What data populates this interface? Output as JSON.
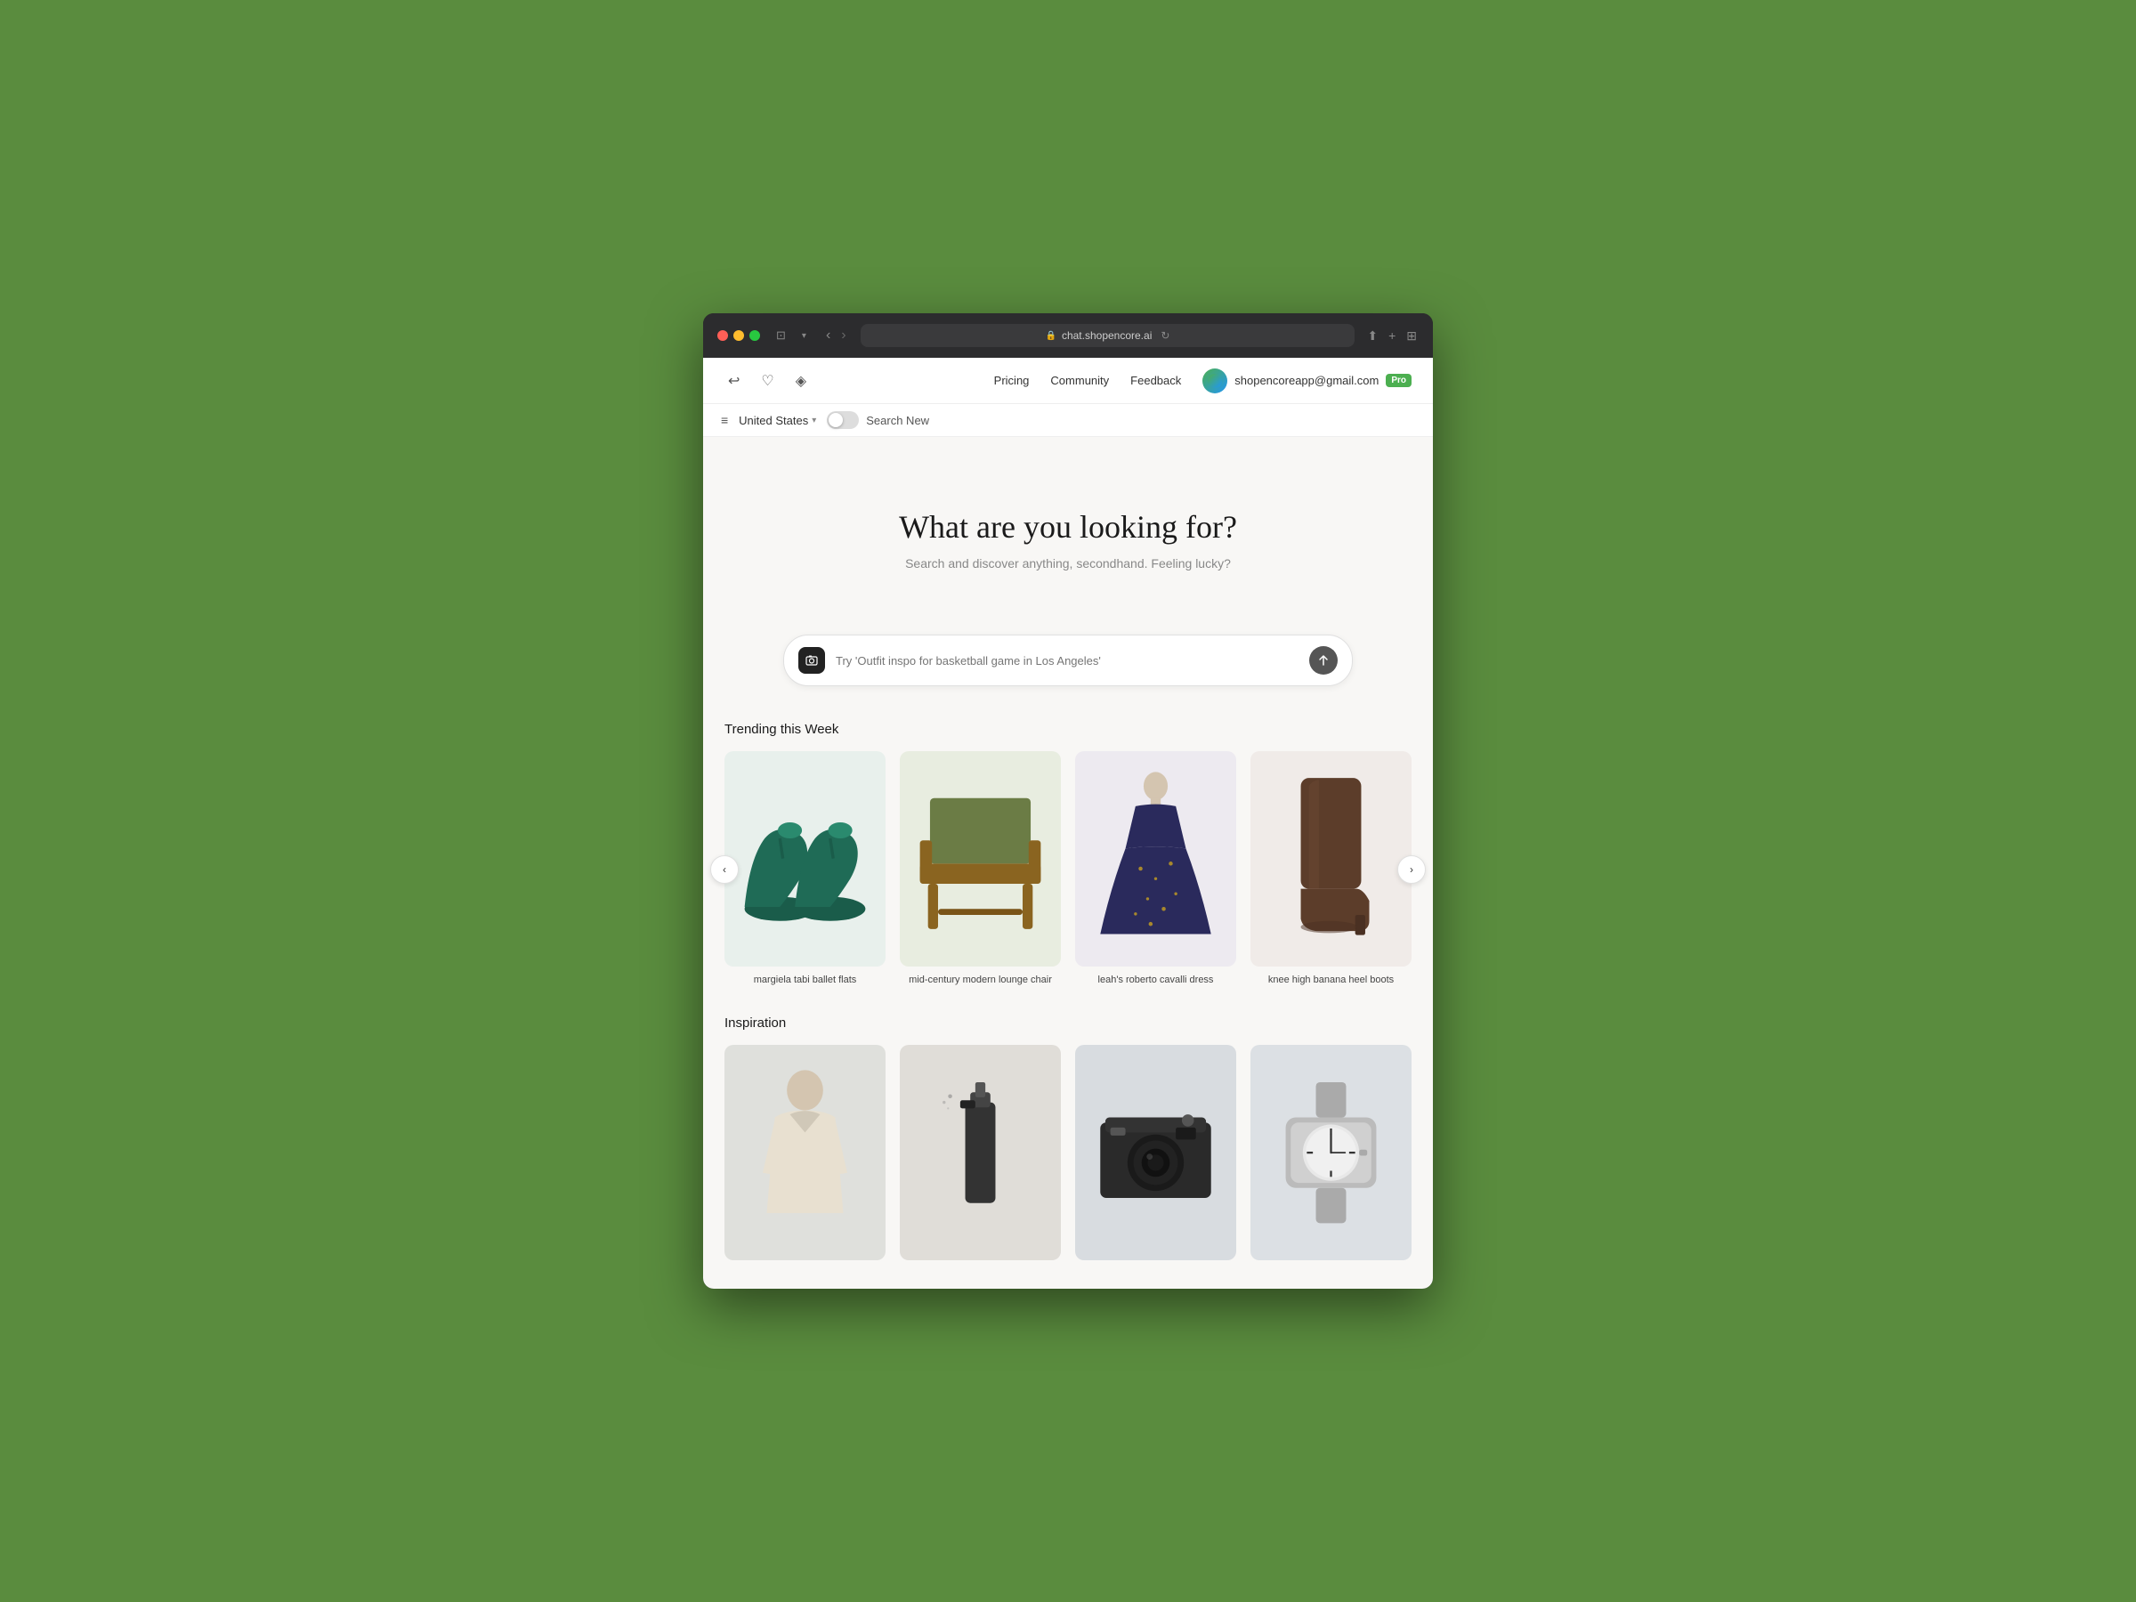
{
  "browser": {
    "url": "chat.shopencore.ai",
    "window_controls": {
      "red": "#ff5f57",
      "yellow": "#febc2e",
      "green": "#28c840"
    }
  },
  "nav": {
    "links": {
      "pricing": "Pricing",
      "community": "Community",
      "feedback": "Feedback"
    },
    "user": {
      "email": "shopencoreapp@gmail.com",
      "pro_badge": "Pro"
    }
  },
  "toolbar": {
    "country": "United States",
    "toggle_label": "Search New"
  },
  "hero": {
    "title": "What are you looking for?",
    "subtitle": "Search and discover anything, secondhand. Feeling lucky?",
    "search_placeholder": "Try 'Outfit inspo for basketball game in Los Angeles'"
  },
  "trending": {
    "section_title": "Trending this Week",
    "products": [
      {
        "name": "margiela tabi ballet flats",
        "bg": "#dce8e2",
        "type": "shoes"
      },
      {
        "name": "mid-century modern lounge chair",
        "bg": "#dde3d4",
        "type": "chair"
      },
      {
        "name": "leah's roberto cavalli dress",
        "bg": "#e8e4ed",
        "type": "dress"
      },
      {
        "name": "knee high banana heel boots",
        "bg": "#ede8e5",
        "type": "boots"
      }
    ]
  },
  "inspiration": {
    "section_title": "Inspiration",
    "items": [
      {
        "bg": "#dfe0dc",
        "type": "fashion"
      },
      {
        "bg": "#e0ddd8",
        "type": "tools"
      },
      {
        "bg": "#d8dce0",
        "type": "camera"
      },
      {
        "bg": "#dce0e4",
        "type": "watch"
      }
    ]
  }
}
